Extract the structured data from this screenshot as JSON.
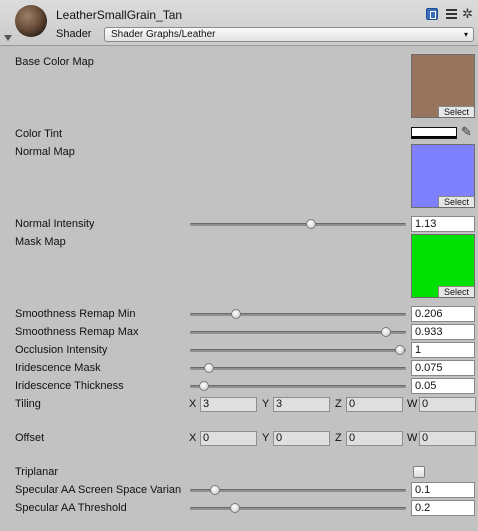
{
  "header": {
    "material_name": "LeatherSmallGrain_Tan",
    "shader_label": "Shader",
    "shader_value": "Shader Graphs/Leather",
    "dropdown_arrow": "▾",
    "gear_glyph": "✲"
  },
  "textures": {
    "select_label": "Select",
    "base_color": {
      "label": "Base Color Map",
      "color": "#97745d"
    },
    "normal": {
      "label": "Normal Map",
      "color": "#7f80ff"
    },
    "mask": {
      "label": "Mask Map",
      "color": "#00e000"
    }
  },
  "color_tint": {
    "label": "Color Tint",
    "color": "#ffffff",
    "picker_glyph": "✎"
  },
  "sliders": [
    {
      "key": "normal_intensity",
      "label": "Normal Intensity",
      "value": "1.13",
      "fraction": 0.57
    },
    {
      "key": "smoothness_min",
      "label": "Smoothness Remap Min",
      "value": "0.206",
      "fraction": 0.206
    },
    {
      "key": "smoothness_max",
      "label": "Smoothness Remap Max",
      "value": "0.933",
      "fraction": 0.933
    },
    {
      "key": "occlusion",
      "label": "Occlusion Intensity",
      "value": "1",
      "fraction": 1.0
    },
    {
      "key": "iri_mask",
      "label": "Iridescence Mask",
      "value": "0.075",
      "fraction": 0.075
    },
    {
      "key": "iri_thickness",
      "label": "Iridescence Thickness",
      "value": "0.05",
      "fraction": 0.05
    },
    {
      "key": "spec_aa_var",
      "label": "Specular AA Screen Space Varian",
      "value": "0.1",
      "fraction": 0.1
    },
    {
      "key": "spec_aa_thr",
      "label": "Specular AA Threshold",
      "value": "0.2",
      "fraction": 0.2
    }
  ],
  "tiling": {
    "label": "Tiling",
    "x": "3",
    "y": "3",
    "z": "0",
    "w": "0"
  },
  "offset": {
    "label": "Offset",
    "x": "0",
    "y": "0",
    "z": "0",
    "w": "0"
  },
  "axis_labels": {
    "x": "X",
    "y": "Y",
    "z": "Z",
    "w": "W"
  },
  "triplanar": {
    "label": "Triplanar",
    "checked": false
  }
}
